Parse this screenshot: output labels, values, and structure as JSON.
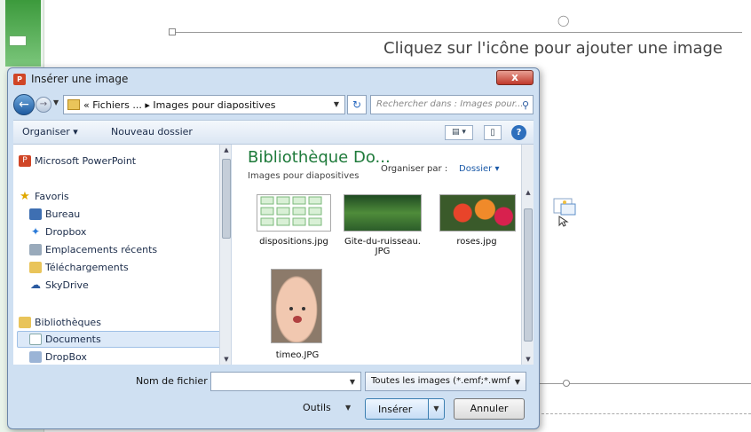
{
  "slide": {
    "placeholder_text": "Cliquez sur l'icône pour ajouter une image"
  },
  "dialog": {
    "title": "Insérer une image",
    "title_icon": "P",
    "close_label": "x",
    "address": {
      "path": "« Fichiers ... ▸ Images pour diapositives",
      "search_placeholder": "Rechercher dans : Images pour..."
    },
    "toolbar": {
      "organize_label": "Organiser ▾",
      "new_folder_label": "Nouveau dossier"
    },
    "nav": {
      "items": [
        {
          "label": "Microsoft PowerPoint",
          "icon": "powerpoint-icon"
        },
        {
          "label": "Favoris",
          "icon": "star-icon"
        },
        {
          "label": "Bureau",
          "icon": "desktop-icon"
        },
        {
          "label": "Dropbox",
          "icon": "dropbox-icon"
        },
        {
          "label": "Emplacements récents",
          "icon": "recent-places-icon"
        },
        {
          "label": "Téléchargements",
          "icon": "downloads-icon"
        },
        {
          "label": "SkyDrive",
          "icon": "skydrive-icon"
        },
        {
          "label": "Bibliothèques",
          "icon": "libraries-icon"
        },
        {
          "label": "Documents",
          "icon": "documents-icon"
        },
        {
          "label": "DropBox",
          "icon": "dropbox-folder-icon"
        }
      ]
    },
    "content": {
      "library_title": "Bibliothèque Do...",
      "library_subtitle": "Images pour diapositives",
      "arrange_label": "Organiser par :",
      "arrange_value": "Dossier ▾",
      "files": [
        {
          "name": "dispositions.jpg"
        },
        {
          "name": "Gite-du-ruisseau.\nJPG"
        },
        {
          "name": "roses.jpg"
        },
        {
          "name": "timeo.JPG"
        }
      ]
    },
    "bottom": {
      "filename_label": "Nom de fichier :",
      "filename_value": "",
      "filter_value": "Toutes les images (*.emf;*.wmf",
      "tools_label": "Outils",
      "insert_label": "Insérer",
      "cancel_label": "Annuler"
    }
  }
}
